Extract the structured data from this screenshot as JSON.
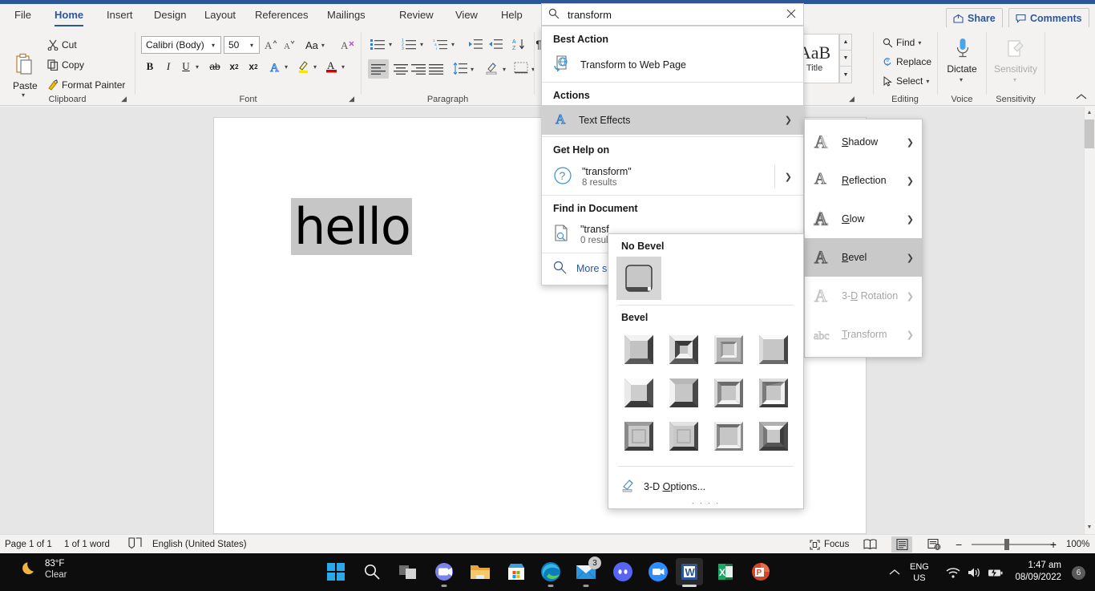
{
  "tabs": [
    {
      "label": "File",
      "active": false
    },
    {
      "label": "Home",
      "active": true
    },
    {
      "label": "Insert",
      "active": false
    },
    {
      "label": "Design",
      "active": false
    },
    {
      "label": "Layout",
      "active": false
    },
    {
      "label": "References",
      "active": false
    },
    {
      "label": "Mailings",
      "active": false
    },
    {
      "label": "Review",
      "active": false
    },
    {
      "label": "View",
      "active": false
    },
    {
      "label": "Help",
      "active": false
    }
  ],
  "window": {
    "share_label": "Share",
    "comments_label": "Comments",
    "collapse_ribbon_icon": "chevron-up-icon"
  },
  "search": {
    "value": "transform",
    "placeholder": "Search",
    "search_icon": "search-icon",
    "clear_icon": "close-icon"
  },
  "search_results": {
    "best_action_header": "Best Action",
    "best_action_item": "Transform to Web Page",
    "actions_header": "Actions",
    "actions_item": "Text Effects",
    "get_help_header": "Get Help on",
    "get_help_query": "\"transform\"",
    "get_help_count": "8 results",
    "find_in_doc_header": "Find in Document",
    "find_query": "\"transf",
    "find_count": "0 resul",
    "more_label": "More s"
  },
  "text_effects_menu": [
    {
      "label_pre": "",
      "mnemonic": "S",
      "label_post": "hadow",
      "disabled": false,
      "highlighted": false,
      "icon": "text-effect-shadow-icon"
    },
    {
      "label_pre": "",
      "mnemonic": "R",
      "label_post": "eflection",
      "disabled": false,
      "highlighted": false,
      "icon": "text-effect-reflection-icon"
    },
    {
      "label_pre": "",
      "mnemonic": "G",
      "label_post": "low",
      "disabled": false,
      "highlighted": false,
      "icon": "text-effect-glow-icon"
    },
    {
      "label_pre": "",
      "mnemonic": "B",
      "label_post": "evel",
      "disabled": false,
      "highlighted": true,
      "icon": "text-effect-bevel-icon"
    },
    {
      "label_pre": "3-",
      "mnemonic": "D",
      "label_post": " Rotation",
      "disabled": true,
      "highlighted": false,
      "icon": "text-effect-3d-rotation-icon"
    },
    {
      "label_pre": "",
      "mnemonic": "T",
      "label_post": "ransform",
      "disabled": true,
      "highlighted": false,
      "icon": "text-effect-transform-icon"
    }
  ],
  "bevel_gallery": {
    "no_bevel_header": "No Bevel",
    "bevel_header": "Bevel",
    "options_label_pre": "3-D ",
    "options_mnemonic": "O",
    "options_label_post": "ptions...",
    "selected_index": -1,
    "no_bevel_selected": true,
    "bevels": [
      {
        "name": "Circle"
      },
      {
        "name": "Relaxed Inset"
      },
      {
        "name": "Cross"
      },
      {
        "name": "Cool Slant"
      },
      {
        "name": "Angle"
      },
      {
        "name": "Soft Round"
      },
      {
        "name": "Convex"
      },
      {
        "name": "Slope"
      },
      {
        "name": "Divot"
      },
      {
        "name": "Riblet"
      },
      {
        "name": "Hard Edge"
      },
      {
        "name": "Art Deco"
      }
    ]
  },
  "ribbon": {
    "clipboard": {
      "group_label": "Clipboard",
      "paste_label": "Paste",
      "cut_label": "Cut",
      "copy_label": "Copy",
      "format_painter_label": "Format Painter"
    },
    "font": {
      "group_label": "Font",
      "font_name": "Calibri (Body)",
      "font_size": "50",
      "grow_font_icon": "grow-font-icon",
      "shrink_font_icon": "shrink-font-icon",
      "change_case_label": "Aa",
      "clear_formatting_icon": "clear-formatting-icon",
      "bold_label": "B",
      "italic_label": "I",
      "underline_label": "U",
      "strikethrough_label": "ab",
      "subscript_label": "x",
      "superscript_label": "x",
      "text_effects_label": "A",
      "highlight_label": "A",
      "font_color_label": "A"
    },
    "paragraph": {
      "group_label": "Paragraph",
      "bullets_icon": "bullets-icon",
      "numbering_icon": "numbering-icon",
      "multilevel_icon": "multilevel-list-icon",
      "decrease_indent_icon": "decrease-indent-icon",
      "increase_indent_icon": "increase-indent-icon",
      "sort_icon": "sort-icon",
      "show_marks_icon": "show-formatting-marks-icon",
      "align_left_icon": "align-left-icon",
      "align_center_icon": "align-center-icon",
      "align_right_icon": "align-right-icon",
      "justify_icon": "justify-icon",
      "line_spacing_icon": "line-spacing-icon",
      "shading_icon": "shading-icon",
      "borders_icon": "borders-icon"
    },
    "styles": {
      "group_label": "Styles",
      "preview_glyph": "AaB",
      "style_name": "Title"
    },
    "editing": {
      "group_label": "Editing",
      "find_label": "Find",
      "replace_label": "Replace",
      "select_label": "Select"
    },
    "voice": {
      "group_label": "Voice",
      "dictate_label": "Dictate"
    },
    "sensitivity": {
      "group_label": "Sensitivity",
      "sensitivity_label": "Sensitivity"
    }
  },
  "document": {
    "text": "hello"
  },
  "status_bar": {
    "page_info": "Page 1 of 1",
    "word_count": "1 of 1 word",
    "proofing_icon": "proofing-icon",
    "language": "English (United States)",
    "focus_label": "Focus",
    "read_mode_icon": "read-mode-icon",
    "print_layout_icon": "print-layout-icon",
    "web_layout_icon": "web-layout-icon",
    "zoom_out_label": "−",
    "zoom_in_label": "+",
    "zoom_level": "100%"
  },
  "taskbar": {
    "weather_temp": "83°F",
    "weather_desc": "Clear",
    "weather_icon": "moon-icon",
    "apps": [
      {
        "name": "start-button",
        "icon": "windows-logo-icon"
      },
      {
        "name": "taskbar-search",
        "icon": "search-icon"
      },
      {
        "name": "task-view",
        "icon": "task-view-icon"
      },
      {
        "name": "taskbar-app-teams",
        "icon": "teams-icon"
      },
      {
        "name": "taskbar-app-file-explorer",
        "icon": "folder-icon"
      },
      {
        "name": "taskbar-app-microsoft-store",
        "icon": "store-icon"
      },
      {
        "name": "taskbar-app-edge",
        "icon": "edge-icon"
      },
      {
        "name": "taskbar-app-mail",
        "icon": "mail-icon",
        "badge": "3"
      },
      {
        "name": "taskbar-app-discord",
        "icon": "discord-icon"
      },
      {
        "name": "taskbar-app-zoom",
        "icon": "zoom-icon"
      },
      {
        "name": "taskbar-app-word",
        "icon": "word-icon"
      },
      {
        "name": "taskbar-app-excel",
        "icon": "excel-icon"
      },
      {
        "name": "taskbar-app-powerpoint",
        "icon": "powerpoint-icon"
      }
    ],
    "tray": {
      "show_hidden_icon": "chevron-up-icon",
      "lang_line1": "ENG",
      "lang_line2": "US",
      "wifi_icon": "wifi-icon",
      "volume_icon": "volume-icon",
      "battery_icon": "battery-charging-icon",
      "time": "1:47 am",
      "date": "08/09/2022",
      "notification_count": "6"
    }
  },
  "colors": {
    "word_blue": "#2b579a",
    "ribbon_bg": "#f3f2f1",
    "selection_gray": "#c6c6c6",
    "highlight_gray": "#d0d0d0"
  }
}
